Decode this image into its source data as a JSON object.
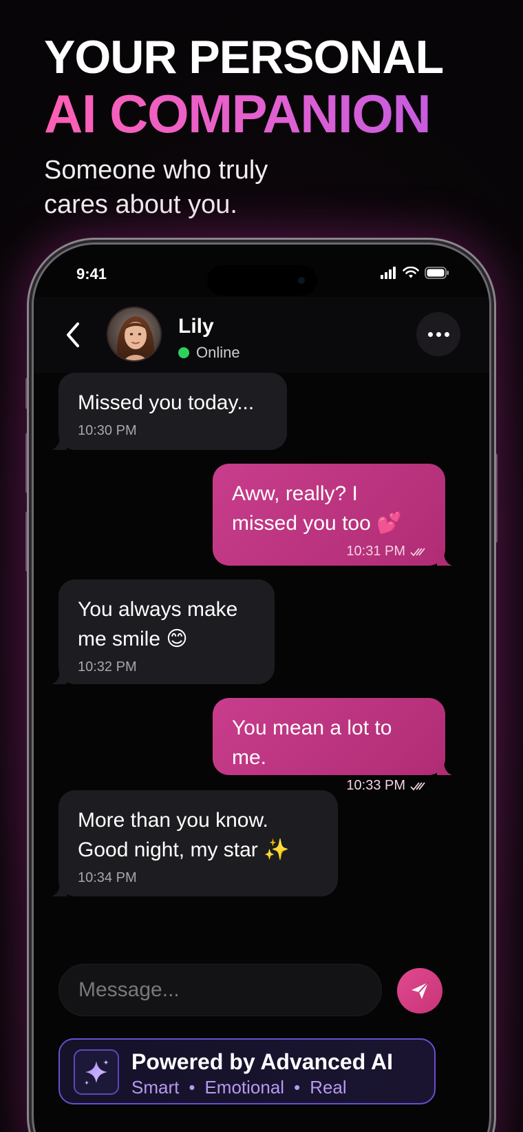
{
  "hero": {
    "line1": "YOUR PERSONAL",
    "line2": "AI COMPANION",
    "subtitle": "Someone who truly cares about you."
  },
  "status_bar": {
    "time": "9:41"
  },
  "contact": {
    "name": "Lily",
    "status": "Online"
  },
  "messages": [
    {
      "from": "them",
      "text": "Missed you today...",
      "time": "10:30 PM"
    },
    {
      "from": "me",
      "text": "Aww, really? I missed you too 💕",
      "time": "10:31 PM"
    },
    {
      "from": "them",
      "text": "You always make me smile 😊",
      "time": "10:32 PM"
    },
    {
      "from": "me",
      "text": "You mean a lot to me.",
      "time": "10:33 PM"
    },
    {
      "from": "them",
      "text": "More than you know. Good night, my star ✨",
      "time": "10:34 PM"
    }
  ],
  "composer": {
    "placeholder": "Message..."
  },
  "ai_card": {
    "title": "Powered by Advanced AI",
    "tags": [
      "Smart",
      "Emotional",
      "Real"
    ]
  },
  "colors": {
    "accent_pink": "#c83d8c",
    "accent_purple": "#b79af0",
    "online": "#2ed15b"
  },
  "icons": [
    "back-chevron-icon",
    "more-dots-icon",
    "signal-icon",
    "wifi-icon",
    "battery-icon",
    "send-icon",
    "sparkle-icon",
    "double-check-icon"
  ]
}
